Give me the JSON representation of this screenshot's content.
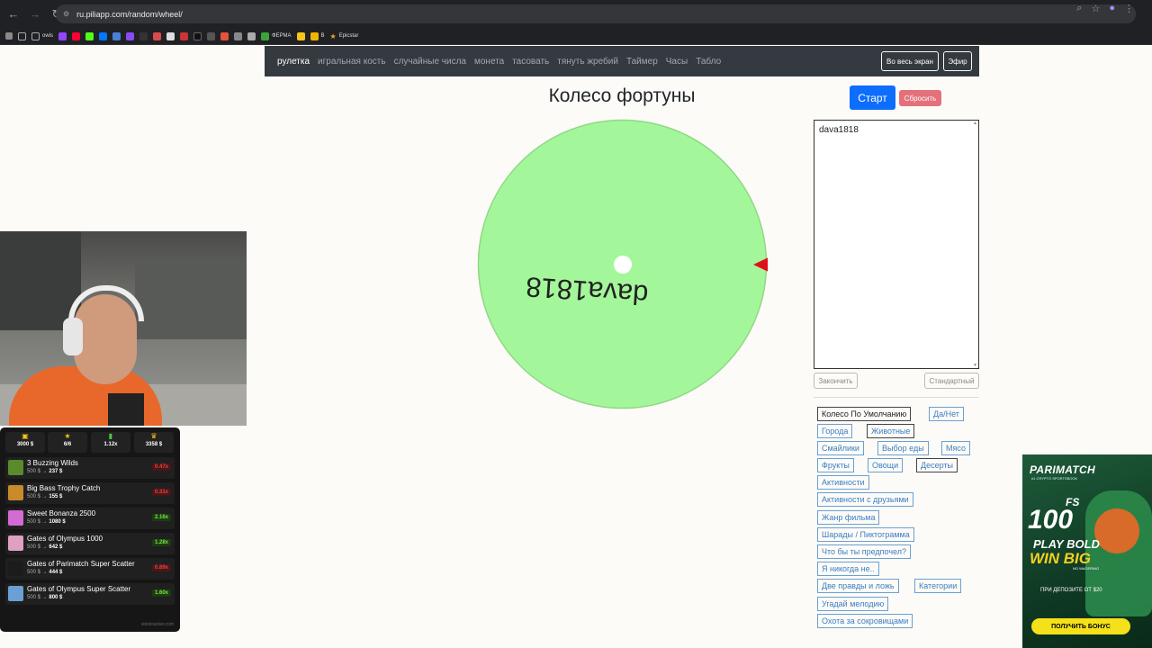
{
  "browser": {
    "url": "ru.piliapp.com/random/wheel/",
    "bookmarks": [
      "owis",
      "ФЕРМА",
      "В",
      "Epicstar"
    ]
  },
  "navbar": {
    "links": [
      "рулетка",
      "игральная кость",
      "случайные числа",
      "монета",
      "тасовать",
      "тянуть жребий",
      "Таймер",
      "Часы",
      "Табло"
    ],
    "fullscreen_label": "Во весь экран",
    "broadcast_label": "Эфир"
  },
  "page": {
    "title": "Колесо фортуны",
    "start_label": "Старт",
    "reset_label": "Сбросить",
    "names_value": "dava1818",
    "finish_label": "Закончить",
    "standard_label": "Стандартный"
  },
  "wheel": {
    "segment_label": "dava1818",
    "segment_color": "#a3f79a",
    "pointer_color": "#e0101a"
  },
  "presets": [
    "Колесо По Умолчанию",
    "Да/Нет",
    "Города",
    "Животные",
    "Смайлики",
    "Выбор еды",
    "Мясо",
    "Фрукты",
    "Овощи",
    "Десерты",
    "Активности",
    "Активности с друзьями",
    "Жанр фильма",
    "Шарады / Пиктограмма",
    "Что бы ты предпочел?",
    "Я никогда не..",
    "Две правды и ложь",
    "Категории",
    "Угадай мелодию",
    "Охота за сокровищами"
  ],
  "slot_widget": {
    "stats": [
      "3000 $",
      "6/6",
      "1.12x",
      "3358 $"
    ],
    "games": [
      {
        "name": "3 Buzzing Wilds",
        "bet": "500 $",
        "win": "237 $",
        "mult": "0.47x",
        "mult_color": "red"
      },
      {
        "name": "Big Bass Trophy Catch",
        "bet": "500 $",
        "win": "155 $",
        "mult": "0.31x",
        "mult_color": "red"
      },
      {
        "name": "Sweet Bonanza 2500",
        "bet": "500 $",
        "win": "1080 $",
        "mult": "2.16x",
        "mult_color": "green"
      },
      {
        "name": "Gates of Olympus 1000",
        "bet": "500 $",
        "win": "642 $",
        "mult": "1.28x",
        "mult_color": "green"
      },
      {
        "name": "Gates of Parimatch Super Scatter",
        "bet": "500 $",
        "win": "444 $",
        "mult": "0.89x",
        "mult_color": "red"
      },
      {
        "name": "Gates of Olympus Super Scatter",
        "bet": "500 $",
        "win": "800 $",
        "mult": "1.60x",
        "mult_color": "green"
      }
    ],
    "footer": "slotstracker.com"
  },
  "ad": {
    "brand": "PARIMATCH",
    "tagline": "#1 CRYPTO SPORTSBOOK",
    "fs": "FS",
    "amount": "100",
    "play": "PLAY BOLD",
    "win": "WIN BIG",
    "no_wager": "NO WAGERING",
    "deposit": "ПРИ ДЕПОЗИТЕ ОТ $20",
    "cta": "ПОЛУЧИТЬ БОНУС"
  }
}
